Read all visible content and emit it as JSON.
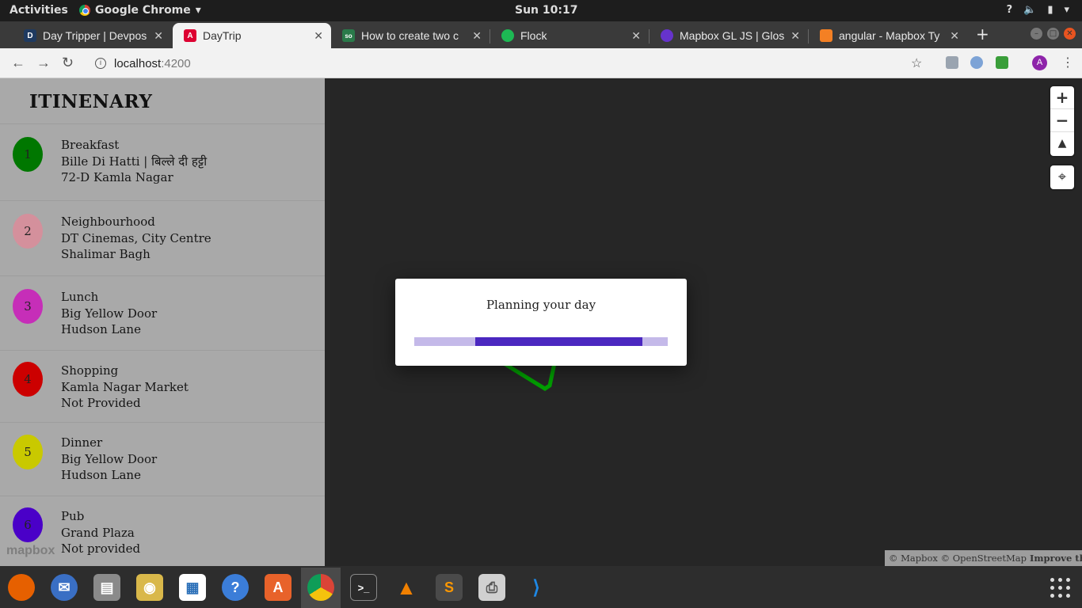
{
  "system": {
    "activities": "Activities",
    "app_name": "Google Chrome",
    "clock": "Sun 10:17",
    "tray": [
      "?",
      "speaker-icon",
      "battery-icon"
    ]
  },
  "tabs": [
    {
      "title": "Day Tripper | Devpos",
      "favicon": "D",
      "color": "#1f3a60",
      "active": false
    },
    {
      "title": "DayTrip",
      "favicon": "A",
      "color": "#dd0031",
      "active": true
    },
    {
      "title": "How to create two c",
      "favicon": "so",
      "color": "#2a7a4a",
      "active": false
    },
    {
      "title": "Flock",
      "favicon": "F",
      "color": "#1db954",
      "active": false
    },
    {
      "title": "Mapbox GL JS | Glos",
      "favicon": "M",
      "color": "#6633cc",
      "active": false
    },
    {
      "title": "angular - Mapbox Ty",
      "favicon": "S",
      "color": "#f48024",
      "active": false
    }
  ],
  "address": {
    "host": "localhost",
    "port": ":4200"
  },
  "avatar_letter": "A",
  "sidebar": {
    "title": "ITINENARY",
    "items": [
      {
        "num": "1",
        "color": "#007700",
        "category": "Breakfast",
        "place": "Bille Di Hatti | बिल्ले दी हट्टी",
        "address": "72-D Kamla Nagar"
      },
      {
        "num": "2",
        "color": "#d4909c",
        "category": "Neighbourhood",
        "place": "DT Cinemas, City Centre",
        "address": "Shalimar Bagh"
      },
      {
        "num": "3",
        "color": "#c62eb8",
        "category": "Lunch",
        "place": "Big Yellow Door",
        "address": "Hudson Lane"
      },
      {
        "num": "4",
        "color": "#cc0000",
        "category": "Shopping",
        "place": "Kamla Nagar Market",
        "address": "Not Provided"
      },
      {
        "num": "5",
        "color": "#c9c900",
        "category": "Dinner",
        "place": "Big Yellow Door",
        "address": "Hudson Lane"
      },
      {
        "num": "6",
        "color": "#4a00c8",
        "category": "Pub",
        "place": "Grand Plaza",
        "address": "Not provided"
      }
    ]
  },
  "map": {
    "logo": "mapbox",
    "attribution": "© Mapbox © OpenStreetMap",
    "improve": "Improve this map",
    "route_color": "#00a000"
  },
  "modal": {
    "message": "Planning your day",
    "progress_start": 0.24,
    "progress_end": 0.9,
    "bar_color": "#4b28c0",
    "track_color": "#c4b9e9"
  },
  "dock_apps": [
    "firefox-icon",
    "thunderbird-icon",
    "files-icon",
    "rhythmbox-icon",
    "libreoffice-writer-icon",
    "help-icon",
    "software-center-icon",
    "chrome-icon",
    "terminal-icon",
    "vlc-icon",
    "sublime-text-icon",
    "printer-icon",
    "vscode-icon"
  ]
}
